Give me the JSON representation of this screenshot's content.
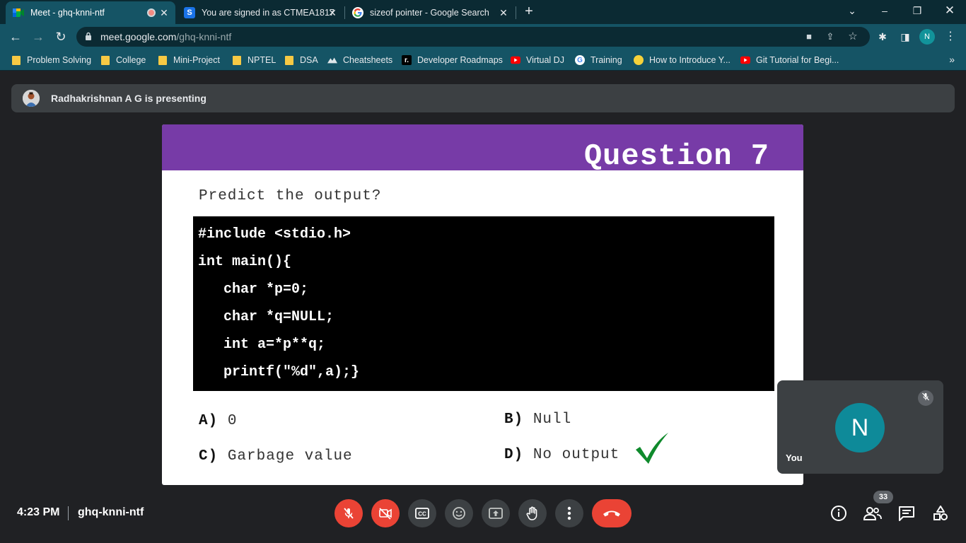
{
  "browser": {
    "tabs": [
      {
        "title": "Meet - ghq-knni-ntf",
        "active": true,
        "recording": true
      },
      {
        "title": "You are signed in as CTMEA1817",
        "active": false
      },
      {
        "title": "sizeof pointer - Google Search",
        "active": false
      }
    ],
    "url_host": "meet.google.com",
    "url_path": "/ghq-knni-ntf",
    "profile_initial": "N",
    "bookmarks": [
      {
        "label": "Problem Solving",
        "icon": "folder-icon"
      },
      {
        "label": "College",
        "icon": "folder-icon"
      },
      {
        "label": "Mini-Project",
        "icon": "folder-icon"
      },
      {
        "label": "NPTEL",
        "icon": "folder-icon"
      },
      {
        "label": "DSA",
        "icon": "folder-icon"
      },
      {
        "label": "Cheatsheets",
        "icon": "mountain-icon"
      },
      {
        "label": "Developer Roadmaps",
        "icon": "roadmap-icon"
      },
      {
        "label": "Virtual DJ",
        "icon": "youtube-icon"
      },
      {
        "label": "Training",
        "icon": "google-icon"
      },
      {
        "label": "How to Introduce Y...",
        "icon": "yellow-circle-icon"
      },
      {
        "label": "Git Tutorial for Begi...",
        "icon": "youtube-icon"
      }
    ],
    "bookmarks_more": "»"
  },
  "meet": {
    "presenter_text": "Radhakrishnan A G is presenting",
    "time": "4:23 PM",
    "meeting_code": "ghq-knni-ntf",
    "participant_count": "33",
    "self_label": "You",
    "self_initial": "N"
  },
  "slide": {
    "title": "Question 7",
    "prompt": "Predict the output?",
    "code_lines": [
      "#include <stdio.h>",
      "int main(){",
      "   char *p=0;",
      "   char *q=NULL;",
      "   int a=*p**q;",
      "   printf(\"%d\",a);}"
    ],
    "options": [
      {
        "key": "A)",
        "text": "0"
      },
      {
        "key": "B)",
        "text": "Null"
      },
      {
        "key": "C)",
        "text": "Garbage value"
      },
      {
        "key": "D)",
        "text": "No output"
      }
    ],
    "correct_option": "D"
  },
  "colors": {
    "tab_bar": "#0b2a33",
    "toolbar": "#155465",
    "meet_bg": "#202124",
    "slide_header": "#773ba7",
    "red_button": "#ea4335",
    "check_green": "#0f8a2c"
  }
}
